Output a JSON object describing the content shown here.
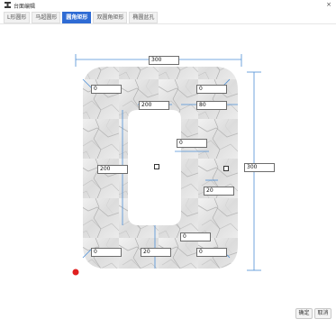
{
  "window": {
    "title": "台面编辑",
    "close_glyph": "×"
  },
  "tabs": [
    {
      "label": "L形圆形"
    },
    {
      "label": "马超圆形"
    },
    {
      "label": "圆角矩形",
      "active": true
    },
    {
      "label": "双圆角矩形"
    },
    {
      "label": "椭圆盆孔"
    }
  ],
  "dimensions": {
    "top_width": "300",
    "right_height": "300",
    "corner_top_left": "0",
    "corner_top_right": "0",
    "corner_bottom_left": "0",
    "corner_bottom_right": "0",
    "cutout_width": "200",
    "cutout_height": "200",
    "cutout_right_margin": "80",
    "cutout_corner_radius": "0",
    "cutout_bottom_margin": "20",
    "cutout_bottom_offset": "0",
    "side_slot_width": "20"
  },
  "footer": {
    "ok_label": "确定",
    "cancel_label": "取消"
  },
  "colors": {
    "accent": "#2e6bd4",
    "dimension_line": "#4d8fd6",
    "origin_marker": "#e02020"
  }
}
